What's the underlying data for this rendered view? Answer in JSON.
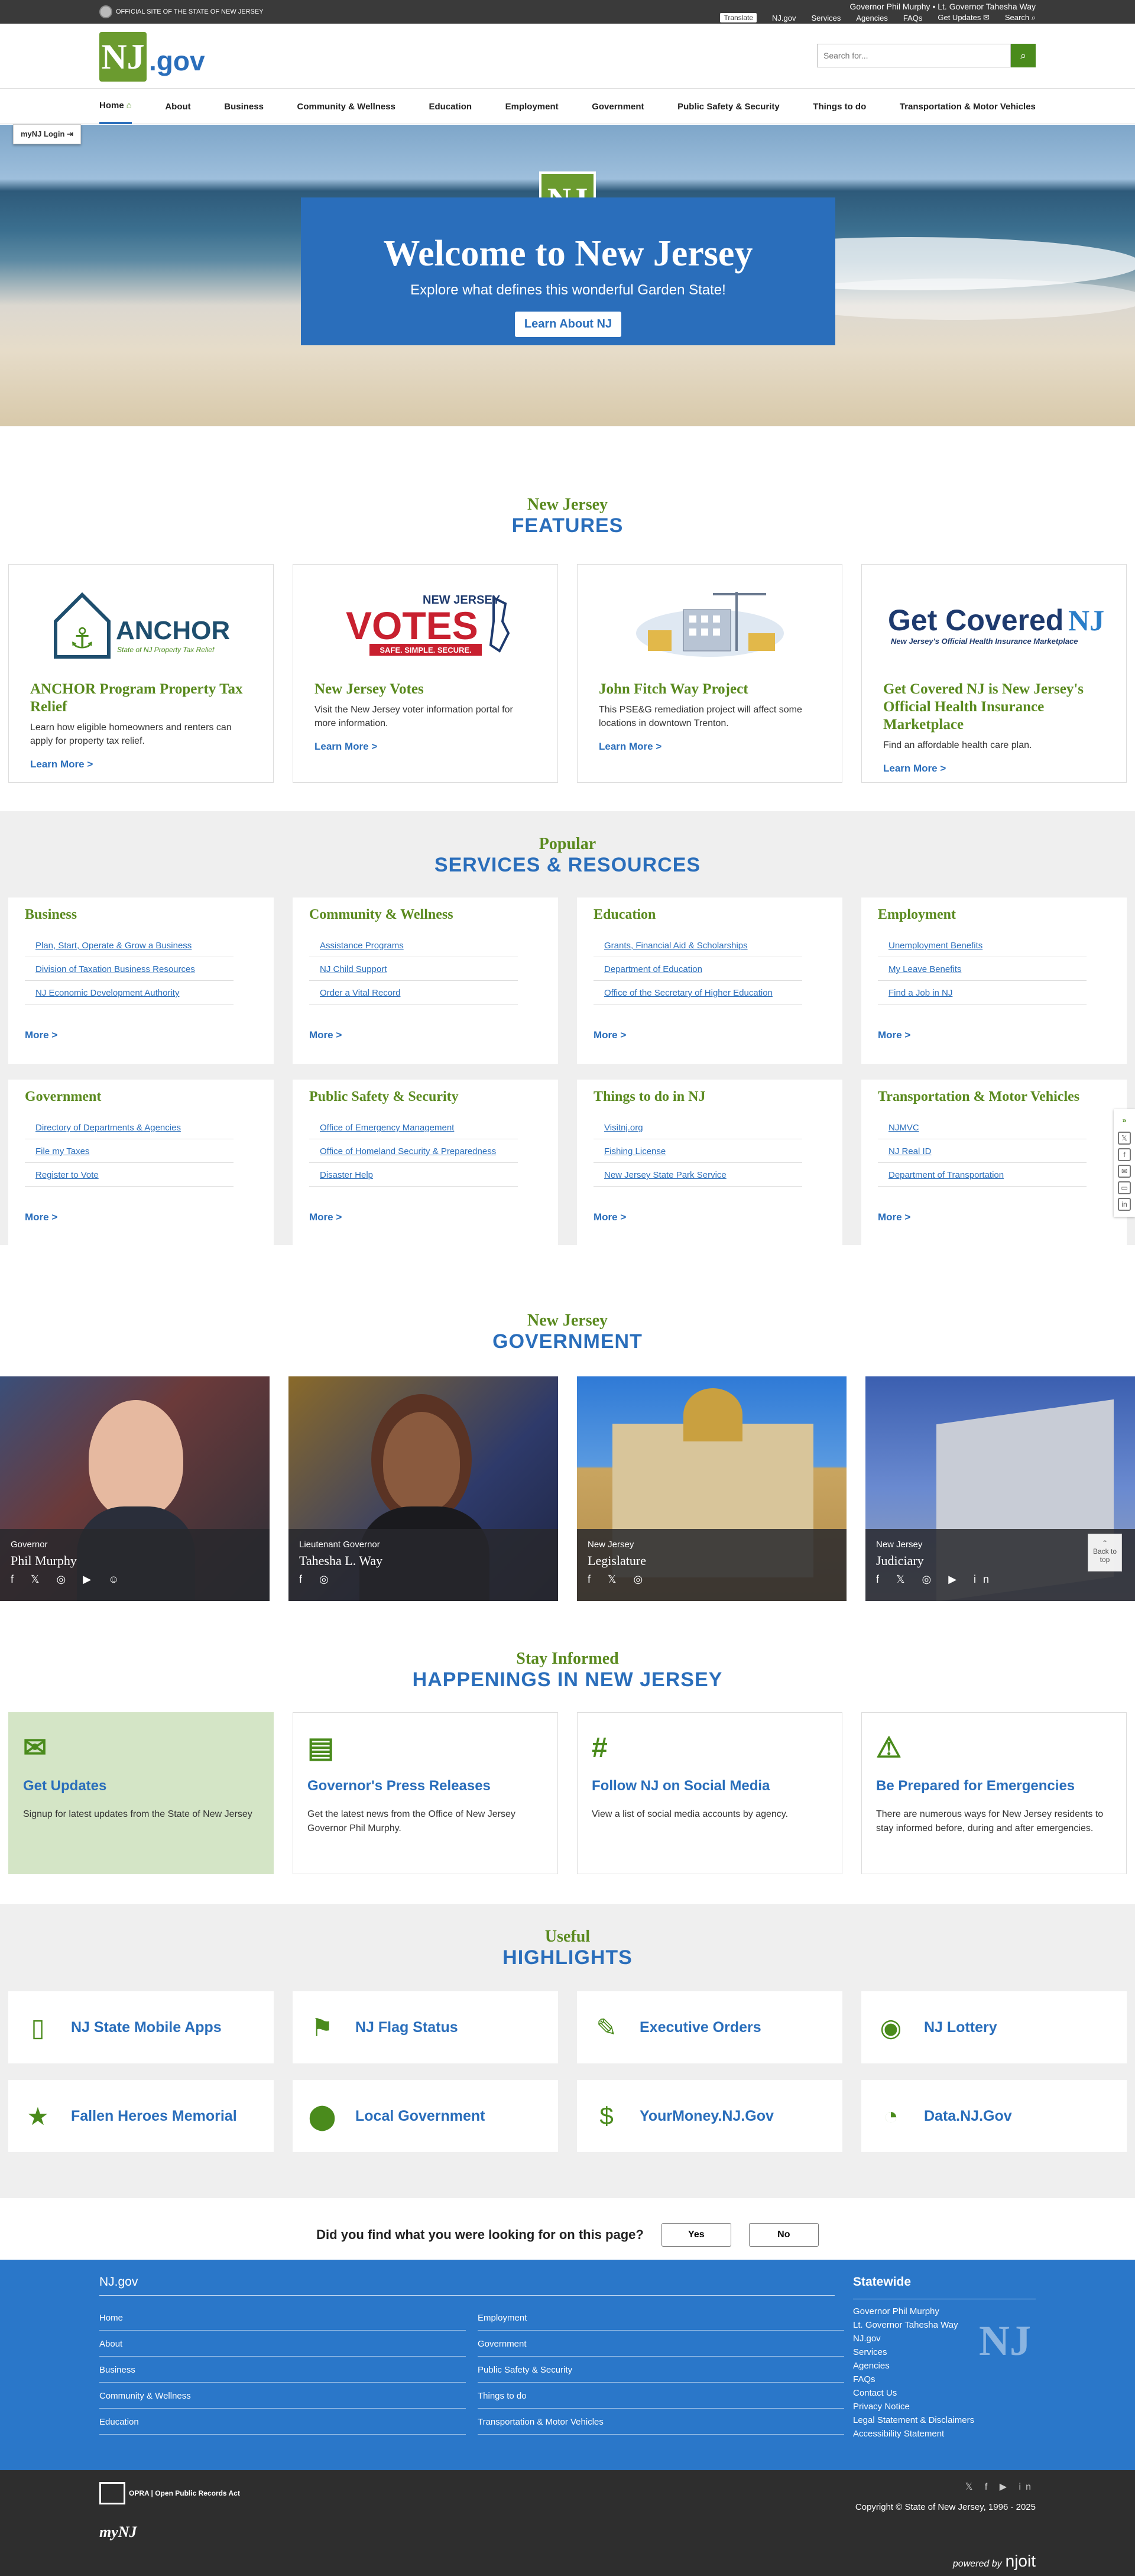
{
  "topbar": {
    "official": "OFFICIAL SITE OF THE STATE OF NEW JERSEY",
    "officials": "Governor Phil Murphy • Lt. Governor Tahesha Way",
    "links": {
      "translate": "Translate",
      "njgov": "NJ.gov",
      "services": "Services",
      "agencies": "Agencies",
      "faqs": "FAQs",
      "updates": "Get Updates",
      "search": "Search"
    }
  },
  "header": {
    "logo_mark": "NJ",
    "logo_suffix": ".gov",
    "search_placeholder": "Search for..."
  },
  "nav": [
    "Home",
    "About",
    "Business",
    "Community & Wellness",
    "Education",
    "Employment",
    "Government",
    "Public Safety & Security",
    "Things to do",
    "Transportation & Motor Vehicles"
  ],
  "mynj": "myNJ Login",
  "hero": {
    "title": "Welcome to New Jersey",
    "subtitle": "Explore what defines this wonderful Garden State!",
    "button": "Learn About NJ"
  },
  "features": {
    "small": "New Jersey",
    "big": "FEATURES",
    "cards": [
      {
        "title": "ANCHOR Program Property Tax Relief",
        "desc": "Learn how eligible homeowners and renters can apply for property tax relief.",
        "link": "Learn More >",
        "img_text": "ANCHOR",
        "img_sub": "State of NJ Property Tax Relief"
      },
      {
        "title": "New Jersey Votes",
        "desc": "Visit the New Jersey voter information portal for more information.",
        "link": "Learn More >",
        "img_text": "VOTES",
        "img_sub": "NEW JERSEY",
        "img_tag": "SAFE. SIMPLE. SECURE."
      },
      {
        "title": "John Fitch Way Project",
        "desc": "This PSE&G remediation project will affect some locations in downtown Trenton.",
        "link": "Learn More >"
      },
      {
        "title": "Get Covered NJ is New Jersey's Official Health Insurance Marketplace",
        "desc": "Find an affordable health care plan.",
        "link": "Learn More >",
        "img_text": "Get Covered",
        "img_mark": "NJ",
        "img_sub": "New Jersey's Official Health Insurance Marketplace"
      }
    ]
  },
  "services": {
    "small": "Popular",
    "big": "SERVICES & RESOURCES",
    "more": "More >",
    "cards": [
      {
        "title": "Business",
        "links": [
          "Plan, Start, Operate & Grow a Business",
          "Division of Taxation Business Resources",
          "NJ Economic Development Authority"
        ]
      },
      {
        "title": "Community & Wellness",
        "links": [
          "Assistance Programs",
          "NJ Child Support",
          "Order a Vital Record"
        ]
      },
      {
        "title": "Education",
        "links": [
          "Grants, Financial Aid & Scholarships",
          "Department of Education",
          "Office of the Secretary of Higher Education"
        ]
      },
      {
        "title": "Employment",
        "links": [
          "Unemployment Benefits",
          "My Leave Benefits",
          "Find a Job in NJ"
        ]
      },
      {
        "title": "Government",
        "links": [
          "Directory of Departments & Agencies",
          "File my Taxes",
          "Register to Vote"
        ]
      },
      {
        "title": "Public Safety & Security",
        "links": [
          "Office of Emergency Management",
          "Office of Homeland Security & Preparedness",
          "Disaster Help"
        ]
      },
      {
        "title": "Things to do in NJ",
        "links": [
          "Visitnj.org",
          "Fishing License",
          "New Jersey State Park Service"
        ]
      },
      {
        "title": "Transportation & Motor Vehicles",
        "links": [
          "NJMVC",
          "NJ Real ID",
          "Department of Transportation"
        ]
      }
    ]
  },
  "government": {
    "small": "New Jersey",
    "big": "GOVERNMENT",
    "cards": [
      {
        "role": "Governor",
        "name": "Phil Murphy",
        "icons": "f 𝕏 ◎ ▶ ☺"
      },
      {
        "role": "Lieutenant Governor",
        "name": "Tahesha L. Way",
        "icons": "f ◎"
      },
      {
        "role": "New Jersey",
        "name": "Legislature",
        "icons": "f 𝕏 ◎"
      },
      {
        "role": "New Jersey",
        "name": "Judiciary",
        "icons": "f 𝕏 ◎ ▶ in"
      }
    ],
    "back_to_top": "Back to top"
  },
  "happenings": {
    "small": "Stay Informed",
    "big": "HAPPENINGS IN NEW JERSEY",
    "cards": [
      {
        "title": "Get Updates",
        "desc": "Signup for latest updates from the State of New Jersey",
        "icon": "✉"
      },
      {
        "title": "Governor's Press Releases",
        "desc": "Get the latest news from the Office of New Jersey Governor Phil Murphy.",
        "icon": "▤"
      },
      {
        "title": "Follow NJ on Social Media",
        "desc": "View a list of social media accounts by agency.",
        "icon": "#"
      },
      {
        "title": "Be Prepared for Emergencies",
        "desc": "There are numerous ways for New Jersey residents to stay informed before, during and after emergencies.",
        "icon": "⚠"
      }
    ]
  },
  "highlights": {
    "small": "Useful",
    "big": "HIGHLIGHTS",
    "cards": [
      {
        "label": "NJ State Mobile Apps",
        "icon": "▯"
      },
      {
        "label": "NJ Flag Status",
        "icon": "⚑"
      },
      {
        "label": "Executive Orders",
        "icon": "✎"
      },
      {
        "label": "NJ Lottery",
        "icon": "◉"
      },
      {
        "label": "Fallen Heroes Memorial",
        "icon": "★"
      },
      {
        "label": "Local Government",
        "icon": "⬤"
      },
      {
        "label": "YourMoney.NJ.Gov",
        "icon": "$"
      },
      {
        "label": "Data.NJ.Gov",
        "icon": "◔"
      }
    ]
  },
  "feedback": {
    "question": "Did you find what you were looking for on this page?",
    "yes": "Yes",
    "no": "No"
  },
  "footer": {
    "head": "NJ.gov",
    "col1": [
      "Home",
      "About",
      "Business",
      "Community & Wellness",
      "Education"
    ],
    "col2": [
      "Employment",
      "Government",
      "Public Safety & Security",
      "Things to do",
      "Transportation & Motor Vehicles"
    ],
    "statewide_title": "Statewide",
    "statewide": [
      "Governor Phil Murphy",
      "Lt. Governor Tahesha Way",
      "NJ.gov",
      "Services",
      "Agencies",
      "FAQs",
      "Contact Us",
      "Privacy Notice",
      "Legal Statement & Disclaimers",
      "Accessibility Statement"
    ]
  },
  "bottom": {
    "opra": "OPRA | Open Public Records Act",
    "mynj": "myNJ",
    "social": "𝕏 f ▶ in",
    "copyright": "Copyright © State of New Jersey, 1996 - 2025",
    "powered": "powered by",
    "powered_brand": "njoit"
  },
  "colors": {
    "blue": "#2a6ebb",
    "green": "#5a8a1f",
    "footer_blue": "#2a77c9"
  }
}
